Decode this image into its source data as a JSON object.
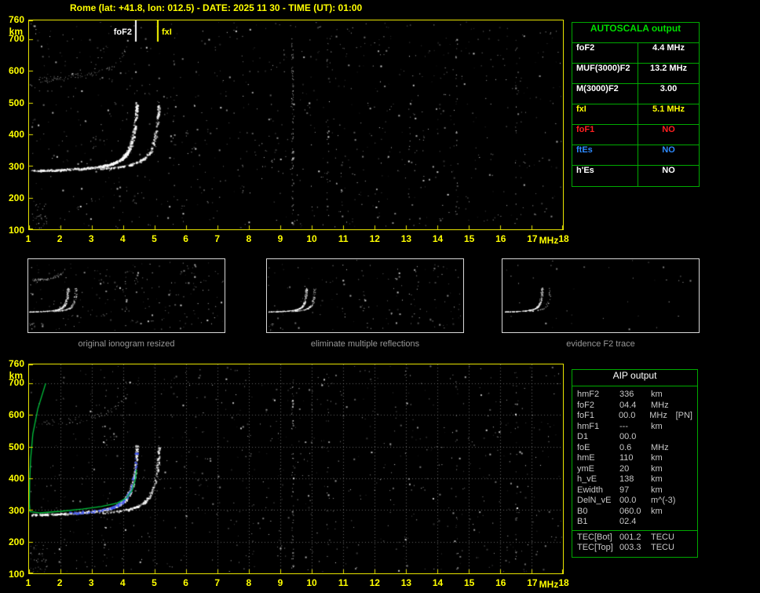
{
  "header": {
    "title": "Rome (lat: +41.8, lon: 012.5) - DATE: 2025 11 30 - TIME (UT): 01:00"
  },
  "ionogram_axes": {
    "y_unit": "km",
    "x_unit": "MHz",
    "y_range": [
      100,
      760
    ],
    "x_range": [
      1,
      18
    ],
    "y_ticks": [
      760,
      700,
      600,
      500,
      400,
      300,
      200,
      100
    ],
    "x_ticks": [
      1,
      2,
      3,
      4,
      5,
      6,
      7,
      8,
      9,
      10,
      11,
      12,
      13,
      14,
      15,
      16,
      17,
      18
    ]
  },
  "top_ionogram": {
    "markers": [
      {
        "label": "foF2",
        "freq_mhz": 4.4,
        "color": "#ffffff",
        "label_side": "left"
      },
      {
        "label": "fxI",
        "freq_mhz": 5.1,
        "color": "#ffff00",
        "label_side": "right"
      }
    ]
  },
  "autoscala": {
    "title": "AUTOSCALA output",
    "rows": [
      {
        "label": "foF2",
        "value": "4.4 MHz",
        "color": "#ffffff"
      },
      {
        "label": "MUF(3000)F2",
        "value": "13.2 MHz",
        "color": "#ffffff"
      },
      {
        "label": "M(3000)F2",
        "value": "3.00",
        "color": "#ffffff"
      },
      {
        "label": "fxI",
        "value": "5.1 MHz",
        "color": "#ffff00"
      },
      {
        "label": "foF1",
        "value": "NO",
        "color": "#ff2020"
      },
      {
        "label": "ftEs",
        "value": "NO",
        "color": "#2e8bff"
      },
      {
        "label": "h'Es",
        "value": "NO",
        "color": "#ffffff"
      }
    ]
  },
  "panels": [
    {
      "caption": "original ionogram resized"
    },
    {
      "caption": "eliminate multiple reflections"
    },
    {
      "caption": "evidence F2 trace"
    }
  ],
  "aip": {
    "title": "AIP output",
    "rows": [
      {
        "label": "hmF2",
        "value": "336",
        "unit": "km"
      },
      {
        "label": "foF2",
        "value": "04.4",
        "unit": "MHz"
      },
      {
        "label": "foF1",
        "value": "00.0",
        "unit": "MHz",
        "note": "[PN]"
      },
      {
        "label": "hmF1",
        "value": "---",
        "unit": "km"
      },
      {
        "label": "D1",
        "value": "00.0",
        "unit": ""
      },
      {
        "label": "foE",
        "value": "0.6",
        "unit": "MHz"
      },
      {
        "label": "hmE",
        "value": "110",
        "unit": "km"
      },
      {
        "label": "ymE",
        "value": "20",
        "unit": "km"
      },
      {
        "label": "h_vE",
        "value": "138",
        "unit": "km"
      },
      {
        "label": "Ewidth",
        "value": "97",
        "unit": "km"
      },
      {
        "label": "DelN_vE",
        "value": "00.0",
        "unit": "m^(-3)"
      },
      {
        "label": "B0",
        "value": "060.0",
        "unit": "km"
      },
      {
        "label": "B1",
        "value": "02.4",
        "unit": ""
      },
      {
        "label": "TEC[Bot]",
        "value": "001.2",
        "unit": "TECU",
        "separator_above": true
      },
      {
        "label": "TEC[Top]",
        "value": "003.3",
        "unit": "TECU"
      }
    ]
  }
}
